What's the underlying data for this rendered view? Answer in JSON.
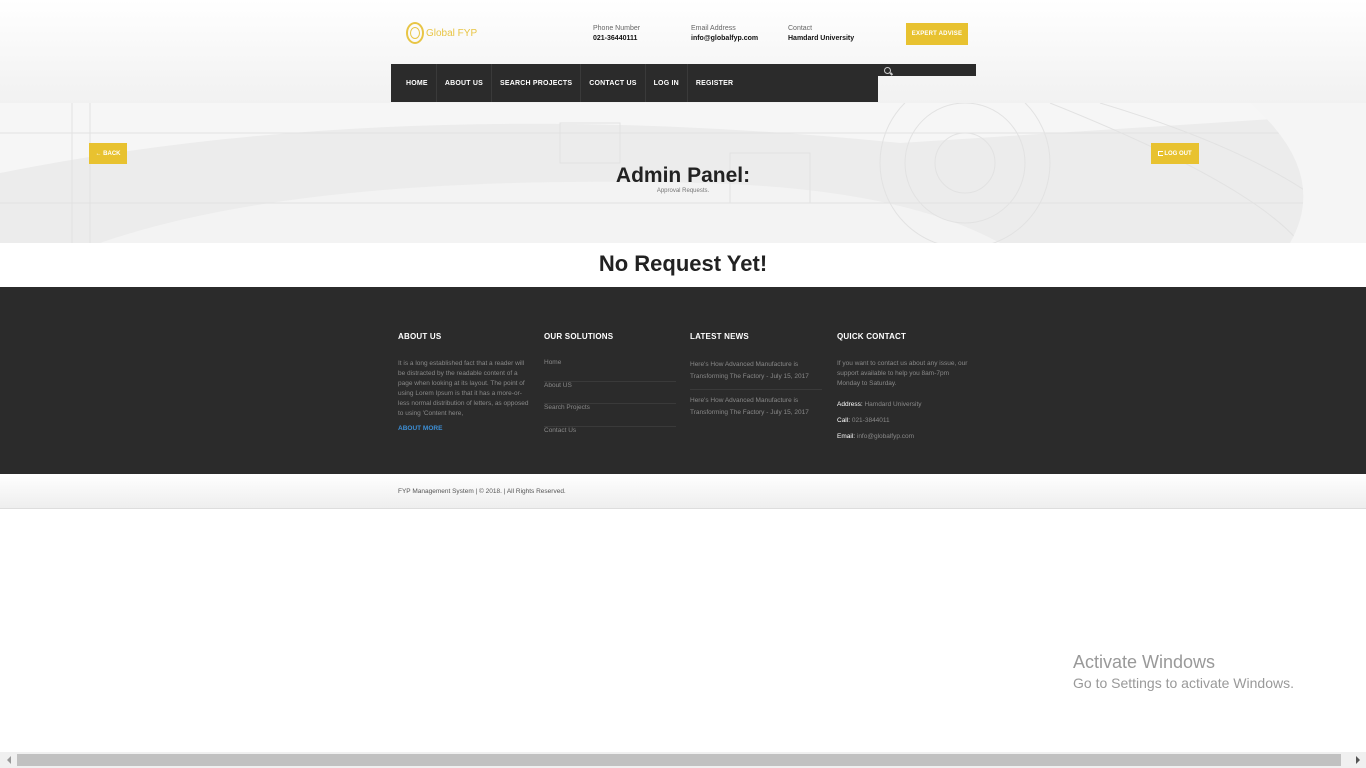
{
  "header": {
    "logo_text": "Global FYP",
    "phone_label": "Phone Number",
    "phone_value": "021-36440111",
    "email_label": "Email Address",
    "email_value": "info@globalfyp.com",
    "contact_label": "Contact",
    "contact_value": "Hamdard University",
    "expert_button": "EXPERT ADVISE"
  },
  "nav": {
    "items": [
      "HOME",
      "ABOUT US",
      "SEARCH PROJECTS",
      "CONTACT US",
      "LOG IN",
      "REGISTER"
    ]
  },
  "banner": {
    "back_button": "← BACK",
    "logout_button": "LOG OUT",
    "title": "Admin Panel:",
    "subtitle": "Approval Requests."
  },
  "main": {
    "empty_message": "No Request Yet!"
  },
  "footer": {
    "about": {
      "heading": "ABOUT US",
      "text": "It is a long established fact that a reader will be distracted by the readable content of a page when looking at its layout. The point of using Lorem Ipsum is that it has a more-or-less normal distribution of letters, as opposed to using 'Content here,",
      "more_link": "ABOUT MORE"
    },
    "solutions": {
      "heading": "OUR SOLUTIONS",
      "items": [
        "Home",
        "About US",
        "Search Projects",
        "Contact Us"
      ]
    },
    "news": {
      "heading": "LATEST NEWS",
      "items": [
        "Here's How Advanced Manufacture is Transforming The Factory - July 15, 2017",
        "Here's How Advanced Manufacture is Transforming The Factory - July 15, 2017"
      ]
    },
    "quick": {
      "heading": "QUICK CONTACT",
      "text": "If you want to contact us about any issue, our support available to help you 8am-7pm Monday to Saturday.",
      "address_label": "Address:",
      "address_value": "Hamdard University",
      "call_label": "Call:",
      "call_value": "021-3844011",
      "email_label": "Email:",
      "email_value": "info@globalfyp.com"
    }
  },
  "copyright": "FYP Management System | © 2018. | All Rights Reserved.",
  "watermark": {
    "title": "Activate Windows",
    "subtitle": "Go to Settings to activate Windows."
  },
  "colors": {
    "accent": "#e8c230",
    "dark": "#2b2b2b",
    "link": "#3d8fd6"
  }
}
